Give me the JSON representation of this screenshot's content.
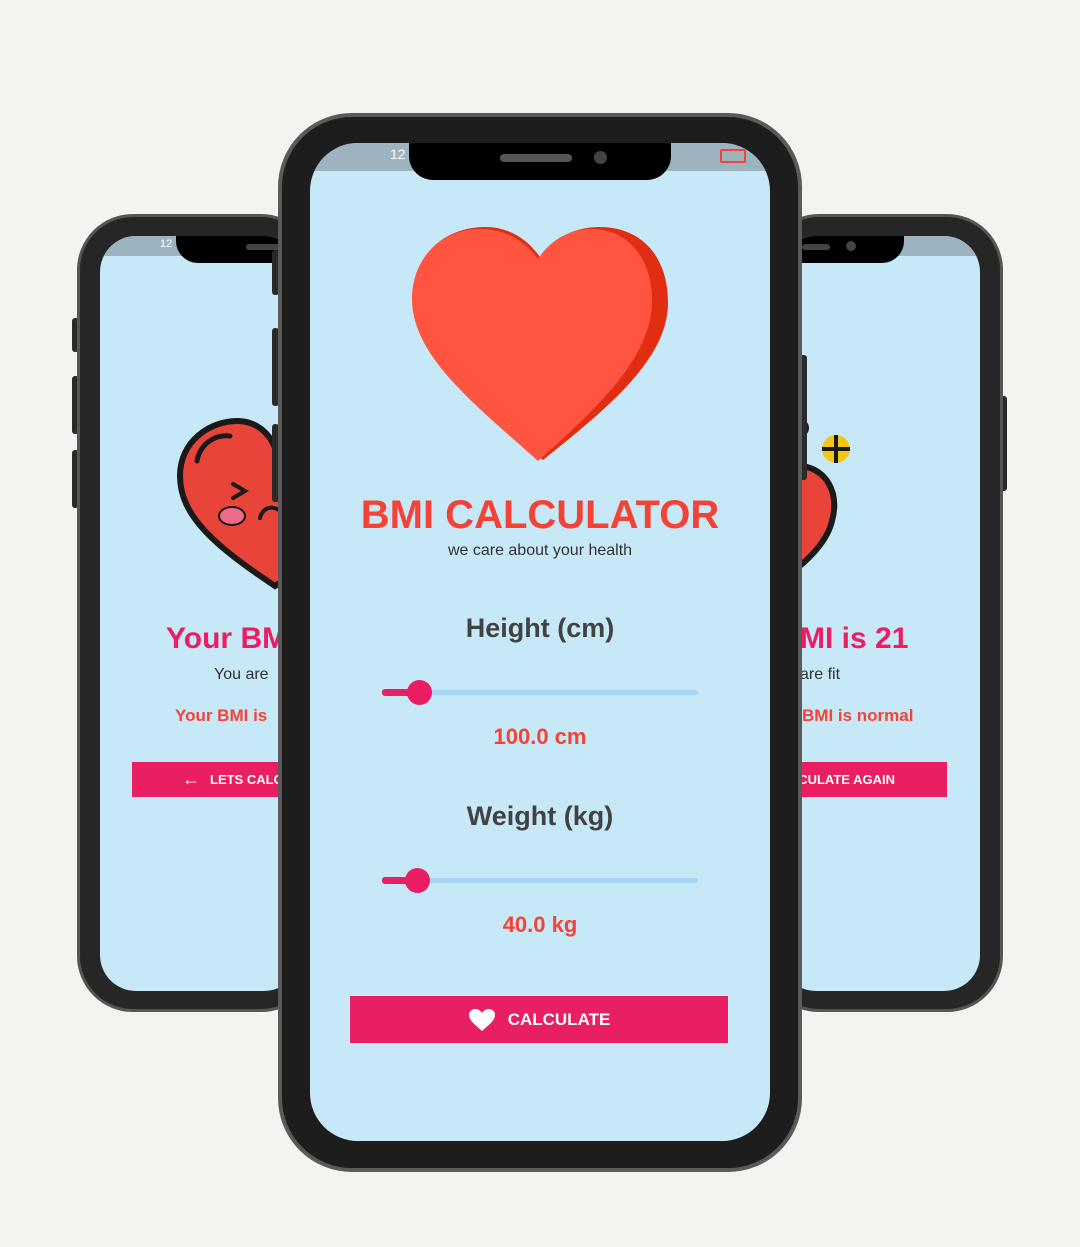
{
  "colors": {
    "background": "#f4f3ef",
    "screen": "#c7e8f7",
    "accent_pink": "#e91e63",
    "accent_red": "#f44336",
    "text_dark": "#424242",
    "heart": "#ff5544"
  },
  "front": {
    "app_title": "BMI CALCULATOR",
    "tagline": "we care about your health",
    "height": {
      "label": "Height (cm)",
      "value_text": "100.0 cm",
      "slider_fraction": 0.12
    },
    "weight": {
      "label": "Weight (kg)",
      "value_text": "40.0 kg",
      "slider_fraction": 0.11
    },
    "calculate_button": "CALCULATE",
    "status_time": "12"
  },
  "left": {
    "heading": "Your BM",
    "subtitle": "You are",
    "result": "Your BMI is",
    "button": "LETS CALC",
    "status_time": "12"
  },
  "right": {
    "heading": "MI is 21",
    "subtitle": "are fit",
    "result": "BMI is normal",
    "button": "CULATE AGAIN"
  },
  "icons": [
    "heart-icon",
    "arrow-left-icon",
    "heart-button-icon"
  ]
}
